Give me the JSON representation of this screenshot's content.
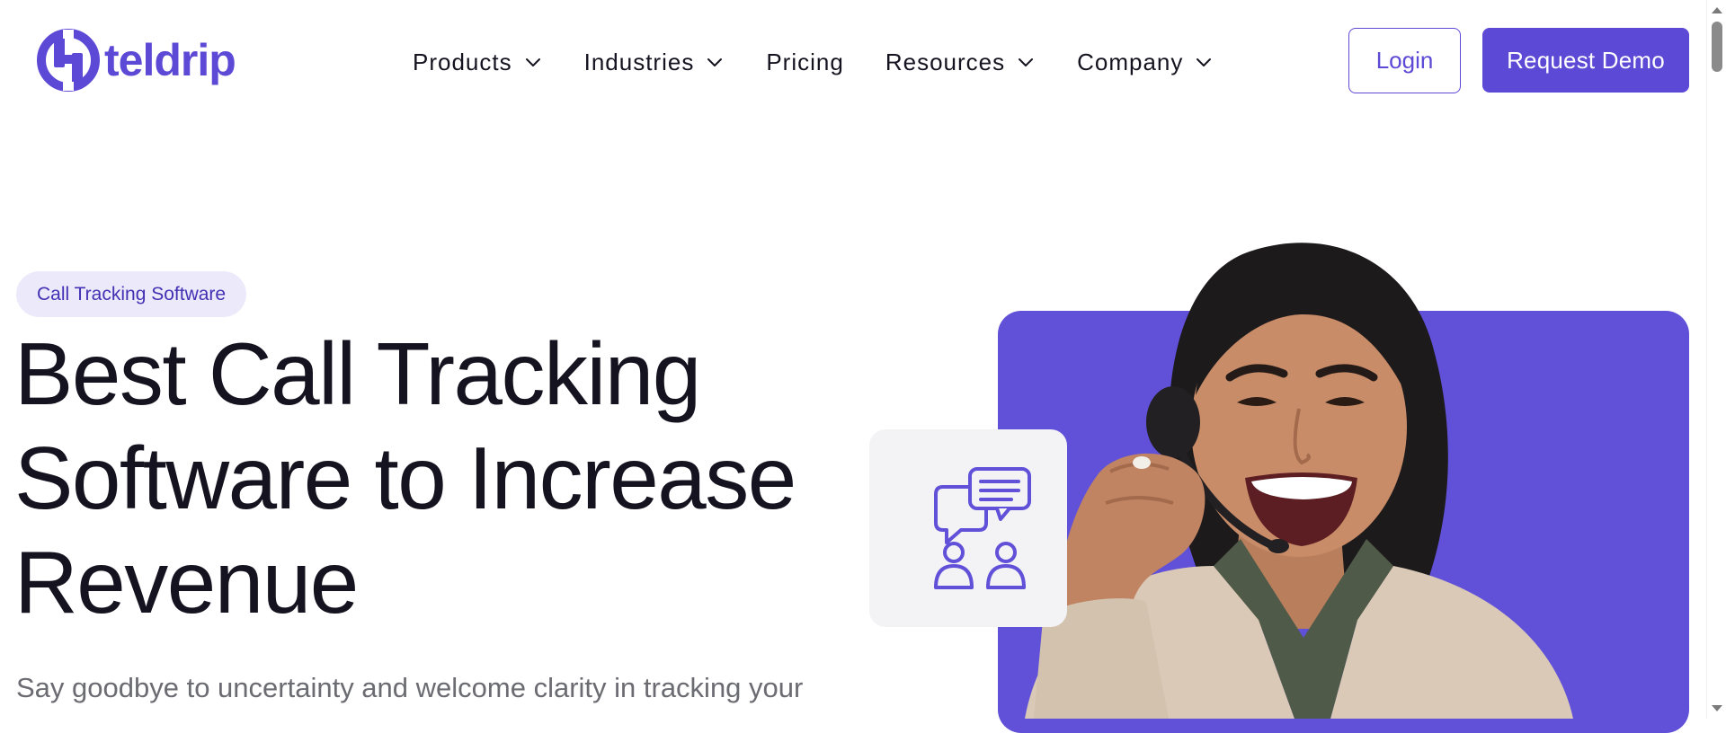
{
  "brand": {
    "name": "teldrip",
    "color": "#5c49d6"
  },
  "nav": {
    "items": [
      {
        "label": "Products",
        "has_dropdown": true
      },
      {
        "label": "Industries",
        "has_dropdown": true
      },
      {
        "label": "Pricing",
        "has_dropdown": false
      },
      {
        "label": "Resources",
        "has_dropdown": true
      },
      {
        "label": "Company",
        "has_dropdown": true
      }
    ],
    "login_label": "Login",
    "demo_label": "Request Demo"
  },
  "hero": {
    "badge": "Call Tracking Software",
    "title": "Best Call Tracking Software to Increase Revenue",
    "subtitle": "Say goodbye to uncertainty and welcome clarity in tracking your"
  },
  "icons": {
    "logo": "teldrip-logo-icon",
    "chevron": "chevron-down-icon",
    "card": "chat-users-icon"
  },
  "colors": {
    "accent": "#5c49d6",
    "panel": "#6150d8",
    "badge_bg": "#ece9fb",
    "text": "#15131f",
    "muted": "#6b6b72"
  }
}
